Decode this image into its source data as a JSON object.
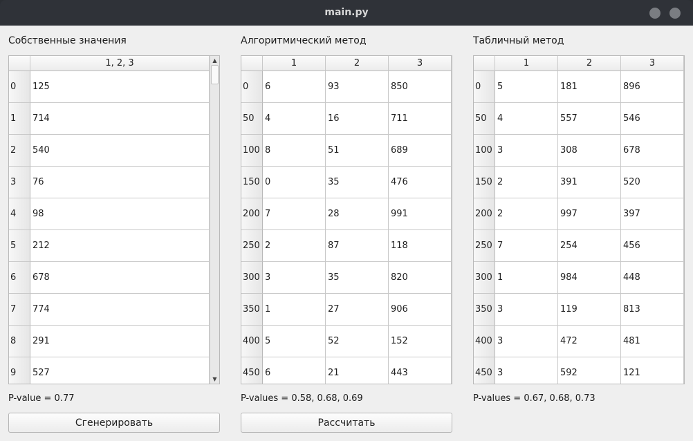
{
  "window": {
    "title": "main.py"
  },
  "panels": [
    {
      "title": "Собственные значения",
      "columns": [
        "1, 2, 3"
      ],
      "rows": [
        {
          "label": "0",
          "cells": [
            "125"
          ]
        },
        {
          "label": "1",
          "cells": [
            "714"
          ]
        },
        {
          "label": "2",
          "cells": [
            "540"
          ]
        },
        {
          "label": "3",
          "cells": [
            "76"
          ]
        },
        {
          "label": "4",
          "cells": [
            "98"
          ]
        },
        {
          "label": "5",
          "cells": [
            "212"
          ]
        },
        {
          "label": "6",
          "cells": [
            "678"
          ]
        },
        {
          "label": "7",
          "cells": [
            "774"
          ]
        },
        {
          "label": "8",
          "cells": [
            "291"
          ]
        },
        {
          "label": "9",
          "cells": [
            "527"
          ]
        }
      ],
      "pvalue": "P-value = 0.77",
      "button": "Сгенерировать"
    },
    {
      "title": "Алгоритмический метод",
      "columns": [
        "1",
        "2",
        "3"
      ],
      "rows": [
        {
          "label": "0",
          "cells": [
            "6",
            "93",
            "850"
          ]
        },
        {
          "label": "50",
          "cells": [
            "4",
            "16",
            "711"
          ]
        },
        {
          "label": "100",
          "cells": [
            "8",
            "51",
            "689"
          ]
        },
        {
          "label": "150",
          "cells": [
            "0",
            "35",
            "476"
          ]
        },
        {
          "label": "200",
          "cells": [
            "7",
            "28",
            "991"
          ]
        },
        {
          "label": "250",
          "cells": [
            "2",
            "87",
            "118"
          ]
        },
        {
          "label": "300",
          "cells": [
            "3",
            "35",
            "820"
          ]
        },
        {
          "label": "350",
          "cells": [
            "1",
            "27",
            "906"
          ]
        },
        {
          "label": "400",
          "cells": [
            "5",
            "52",
            "152"
          ]
        },
        {
          "label": "450",
          "cells": [
            "6",
            "21",
            "443"
          ]
        }
      ],
      "pvalue": "P-values = 0.58, 0.68, 0.69",
      "button": "Рассчитать"
    },
    {
      "title": "Табличный метод",
      "columns": [
        "1",
        "2",
        "3"
      ],
      "rows": [
        {
          "label": "0",
          "cells": [
            "5",
            "181",
            "896"
          ]
        },
        {
          "label": "50",
          "cells": [
            "4",
            "557",
            "546"
          ]
        },
        {
          "label": "100",
          "cells": [
            "3",
            "308",
            "678"
          ]
        },
        {
          "label": "150",
          "cells": [
            "2",
            "391",
            "520"
          ]
        },
        {
          "label": "200",
          "cells": [
            "2",
            "997",
            "397"
          ]
        },
        {
          "label": "250",
          "cells": [
            "7",
            "254",
            "456"
          ]
        },
        {
          "label": "300",
          "cells": [
            "1",
            "984",
            "448"
          ]
        },
        {
          "label": "350",
          "cells": [
            "3",
            "119",
            "813"
          ]
        },
        {
          "label": "400",
          "cells": [
            "3",
            "472",
            "481"
          ]
        },
        {
          "label": "450",
          "cells": [
            "3",
            "592",
            "121"
          ]
        }
      ],
      "pvalue": "P-values = 0.67, 0.68, 0.73"
    }
  ],
  "icons": {
    "scroll_up": "scroll-up-arrow-icon",
    "scroll_down": "scroll-down-arrow-icon"
  }
}
